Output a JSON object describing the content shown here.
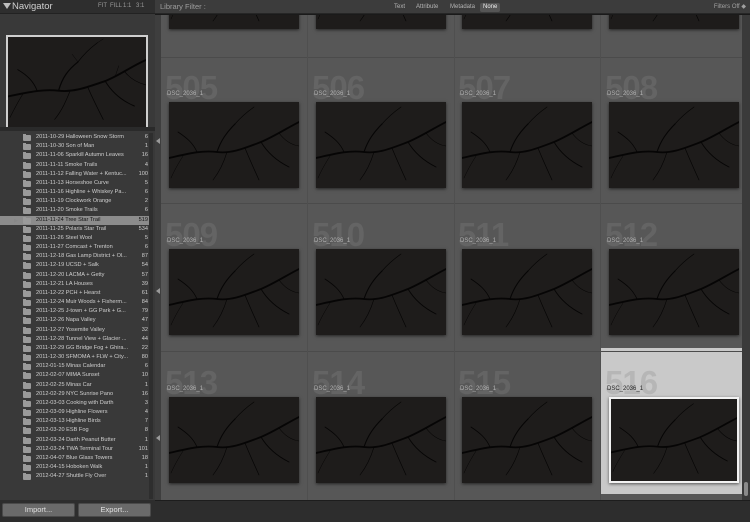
{
  "navigator": {
    "title": "Navigator",
    "zoom_options": [
      "FIT",
      "FILL",
      "1:1",
      "3:1"
    ]
  },
  "folders": [
    {
      "name": "2011-10-29 Halloween Snow Storm",
      "count": "6"
    },
    {
      "name": "2011-10-30 Son of Man",
      "count": "1"
    },
    {
      "name": "2011-11-06 Sparkill Autumn Leaves",
      "count": "16"
    },
    {
      "name": "2011-11-11 Smoke Trails",
      "count": "4"
    },
    {
      "name": "2011-11-12 Falling Water + Kentuc...",
      "count": "100"
    },
    {
      "name": "2011-11-13 Horseshoe Curve",
      "count": "5"
    },
    {
      "name": "2011-11-16 Highline + Whiskey Pa...",
      "count": "6"
    },
    {
      "name": "2011-11-19 Clockwork Orange",
      "count": "2"
    },
    {
      "name": "2011-11-20 Smoke Trails",
      "count": "6"
    },
    {
      "name": "2011-11-24 Tree Star Trail",
      "count": "519",
      "selected": true
    },
    {
      "name": "2011-11-25 Polaris Star Trail",
      "count": "534"
    },
    {
      "name": "2011-11-26 Steel Wool",
      "count": "5"
    },
    {
      "name": "2011-11-27 Comcast + Trenton",
      "count": "6"
    },
    {
      "name": "2011-12-18 Gas Lamp District + Ol...",
      "count": "87"
    },
    {
      "name": "2011-12-19 UCSD + Salk",
      "count": "54"
    },
    {
      "name": "2011-12-20 LACMA + Getty",
      "count": "57"
    },
    {
      "name": "2011-12-21 LA Houses",
      "count": "39"
    },
    {
      "name": "2011-12-22 PCH + Hearst",
      "count": "61"
    },
    {
      "name": "2011-12-24 Muir Woods + Fisherm...",
      "count": "84"
    },
    {
      "name": "2011-12-25 J-town + GG Park + G...",
      "count": "79"
    },
    {
      "name": "2011-12-26 Napa Valley",
      "count": "47"
    },
    {
      "name": "2011-12-27 Yosemite Valley",
      "count": "32"
    },
    {
      "name": "2011-12-28 Tunnel View + Glacier ...",
      "count": "44"
    },
    {
      "name": "2011-12-29 GG Bridge Fog + Ghira...",
      "count": "22"
    },
    {
      "name": "2011-12-30 SFMOMA + FLW + City...",
      "count": "80"
    },
    {
      "name": "2012-01-15 Minas Calendar",
      "count": "6"
    },
    {
      "name": "2012-02-07 MIMA Sunset",
      "count": "10"
    },
    {
      "name": "2012-02-25 Minas Car",
      "count": "1"
    },
    {
      "name": "2012-02-29 NYC Sunrise Pano",
      "count": "16"
    },
    {
      "name": "2012-03-03 Cooking with Darth",
      "count": "3"
    },
    {
      "name": "2012-03-09 Highline Flowers",
      "count": "4"
    },
    {
      "name": "2012-03-13 Highline Birds",
      "count": "7"
    },
    {
      "name": "2012-03-20 ESB Fog",
      "count": "8"
    },
    {
      "name": "2012-03-24 Darth Peanut Butter",
      "count": "1"
    },
    {
      "name": "2012-03-24 TWA Terminal Tour",
      "count": "101"
    },
    {
      "name": "2012-04-07 Blue Glass Towers",
      "count": "18"
    },
    {
      "name": "2012-04-15 Hoboken Walk",
      "count": "1"
    },
    {
      "name": "2012-04-27 Shuttle Fly Over",
      "count": "1"
    }
  ],
  "buttons": {
    "import": "Import...",
    "export": "Export..."
  },
  "filter_bar": {
    "label": "Library Filter :",
    "options": [
      "Text",
      "Attribute",
      "Metadata",
      "None"
    ],
    "active": "None",
    "filters_off": "Filters Off ◆"
  },
  "grid": {
    "columns": 4,
    "cells": [
      {
        "number": "505",
        "filename": "DSC_2036_1"
      },
      {
        "number": "506",
        "filename": "DSC_2036_1"
      },
      {
        "number": "507",
        "filename": "DSC_2036_1"
      },
      {
        "number": "508",
        "filename": "DSC_2036_1"
      },
      {
        "number": "509",
        "filename": "DSC_2036_1"
      },
      {
        "number": "510",
        "filename": "DSC_2036_1"
      },
      {
        "number": "511",
        "filename": "DSC_2036_1"
      },
      {
        "number": "512",
        "filename": "DSC_2036_1"
      },
      {
        "number": "513",
        "filename": "DSC_2036_1"
      },
      {
        "number": "514",
        "filename": "DSC_2036_1"
      },
      {
        "number": "515",
        "filename": "DSC_2036_1"
      },
      {
        "number": "516",
        "filename": "DSC_2036_1",
        "selected": true
      }
    ]
  },
  "colors": {
    "panel": "#393939",
    "grid_bg": "#575757",
    "selected_cell": "#c9c9c9",
    "thumb": "#1e1c1b"
  }
}
